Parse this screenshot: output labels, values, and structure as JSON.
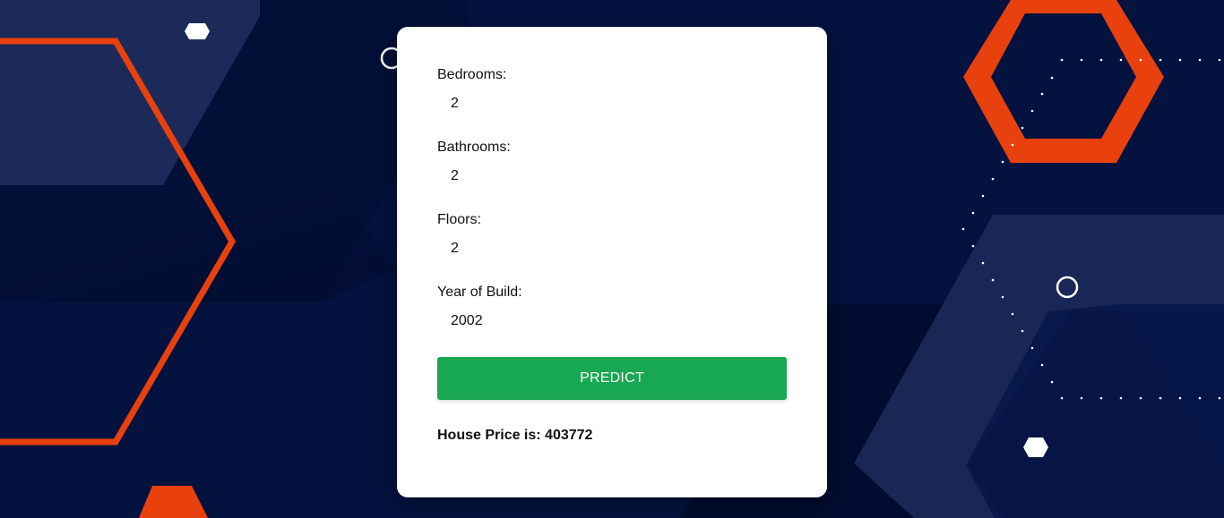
{
  "form": {
    "fields": [
      {
        "label": "Bedrooms:",
        "value": "2"
      },
      {
        "label": "Bathrooms:",
        "value": "2"
      },
      {
        "label": "Floors:",
        "value": "2"
      },
      {
        "label": "Year of Build:",
        "value": "2002"
      }
    ],
    "predict_label": "PREDICT",
    "result_text": "House Price is: 403772"
  },
  "colors": {
    "background": "#03123f",
    "accent_orange": "#e8410e",
    "button_green": "#18a853",
    "card": "#ffffff"
  }
}
